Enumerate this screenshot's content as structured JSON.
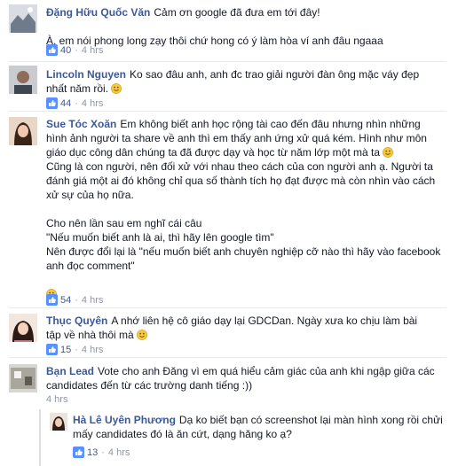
{
  "comments": [
    {
      "author": "Đặng Hữu Quốc Văn",
      "paragraphs": [
        "Cảm ơn google đã đưa em tới đây!",
        "",
        "À, em nói phong long zạy thôi chứ hong có ý làm hòa ví anh đâu ngaaa"
      ],
      "likes": "40",
      "time": "4 hrs"
    },
    {
      "author": "Lincoln Nguyen",
      "line1": "Ko sao đâu anh, anh đc trao giải người đàn ông mặc váy đẹp",
      "line2": "nhất năm rồi.",
      "likes": "44",
      "time": "4 hrs"
    },
    {
      "author": "Sue Tóc Xoăn",
      "block1": "Em không biết anh học rộng tài cao đến đâu nhưng nhìn những hình ảnh người ta share về anh thì em thấy anh ứng xử quá kém. Hình như môn giáo dục công dân chúng ta đã được dạy và học từ năm lớp một mà ta",
      "block1b": "Cũng là con người, nên đối xử với nhau theo cách của con người anh ạ. Người ta đánh giá một ai đó không chỉ qua số thành tích họ đạt được mà còn nhìn vào cách xử sự của họ nữa.",
      "block2": "Cho nên lần sau em nghĩ cái câu",
      "quote1": "\"Nếu muốn biết anh là ai, thì hãy lên google tìm\"",
      "block3": "Nên được đổi lại là \"nếu muốn biết anh chuyên nghiệp cỡ nào thì hãy vào facebook anh đọc comment\"",
      "likes": "54",
      "time": "4 hrs"
    },
    {
      "author": "Thục Quyên",
      "line1": "A nhớ liên hệ cô giáo dạy lại GDCDan. Ngày xưa ko chịu làm bài",
      "line2": "tập về nhà thôi mà",
      "likes": "15",
      "time": "4 hrs"
    },
    {
      "author": "Bạn Lead",
      "text": "Vote cho anh Đăng vì em quá hiểu cảm giác của anh khi ngập giữa các candidates đến từ các trường danh tiếng :))",
      "time": "4 hrs"
    },
    {
      "author": "Hà Lê Uyên Phương",
      "text": "Dạ ko biết bạn có screenshot lại màn hình xong rồi chửi mấy candidates đó là ăn cứt, dạng hăng ko ạ?",
      "likes": "13",
      "time": "4 hrs"
    }
  ],
  "icons": {
    "like": "like-icon",
    "emoji": "smile-emoji-icon"
  },
  "colors": {
    "author": "#3b5998",
    "meta": "#9197a3",
    "like_badge": "#5890ff",
    "emoji": "#f7c93d"
  }
}
